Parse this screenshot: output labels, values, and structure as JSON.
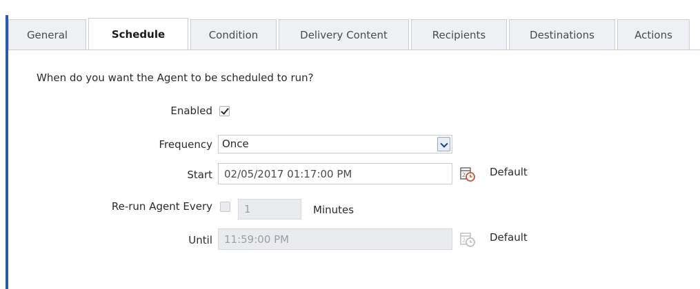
{
  "tabs": [
    "General",
    "Schedule",
    "Condition",
    "Delivery Content",
    "Recipients",
    "Destinations",
    "Actions"
  ],
  "active_tab": "Schedule",
  "question": "When do you want the Agent to be scheduled to run?",
  "form": {
    "enabled": {
      "label": "Enabled",
      "checked": true
    },
    "frequency": {
      "label": "Frequency",
      "value": "Once"
    },
    "start": {
      "label": "Start",
      "value": "02/05/2017 01:17:00 PM",
      "default_label": "Default"
    },
    "rerun": {
      "label": "Re-run Agent Every",
      "checked": false,
      "value": "1",
      "unit": "Minutes"
    },
    "until": {
      "label": "Until",
      "value": "11:59:00 PM",
      "default_label": "Default"
    }
  },
  "icons": {
    "calendar": "calendar-clock-icon",
    "dropdown": "chevron-down-icon",
    "check": "checkmark-icon"
  },
  "colors": {
    "accent_bar": "#2e5aa8",
    "tab_bg": "#eef0f3",
    "disabled_bg": "#e9ebee",
    "icon_clock": "#c8562b"
  }
}
